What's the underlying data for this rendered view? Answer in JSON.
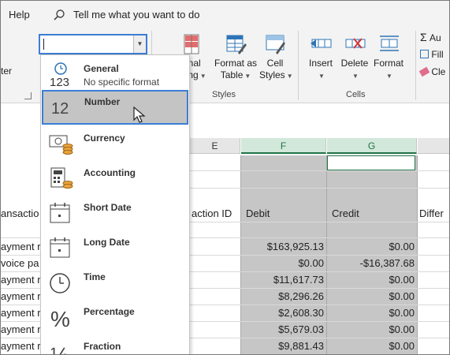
{
  "menubar": {
    "help": "Help",
    "tell_me": "Tell me what you want to do"
  },
  "ribbon": {
    "left_cut_label": "ter",
    "number_format_value": "",
    "conditional_line1": "ional",
    "conditional_line2": "atting",
    "format_as_table_line1": "Format as",
    "format_as_table_line2": "Table",
    "cell_styles_line1": "Cell",
    "cell_styles_line2": "Styles",
    "styles_group": "Styles",
    "insert": "Insert",
    "delete": "Delete",
    "format": "Format",
    "cells_group": "Cells",
    "autosum": "Au",
    "fill": "Fill",
    "clear": "Cle"
  },
  "dropdown": {
    "items": [
      {
        "label": "General",
        "sub": "No specific format",
        "icon": "general-123-icon"
      },
      {
        "label": "Number",
        "sub": "",
        "icon": "number-12-icon"
      },
      {
        "label": "Currency",
        "sub": "",
        "icon": "currency-icon"
      },
      {
        "label": "Accounting",
        "sub": "",
        "icon": "accounting-icon"
      },
      {
        "label": "Short Date",
        "sub": "",
        "icon": "short-date-icon"
      },
      {
        "label": "Long Date",
        "sub": "",
        "icon": "long-date-icon"
      },
      {
        "label": "Time",
        "sub": "",
        "icon": "clock-icon"
      },
      {
        "label": "Percentage",
        "sub": "",
        "icon": "percent-icon"
      },
      {
        "label": "Fraction",
        "sub": "",
        "icon": "fraction-icon"
      }
    ],
    "number_glyph": "12",
    "general_glyph": "123",
    "percent_glyph": "%",
    "fraction_glyph": "½"
  },
  "sheet": {
    "columns": {
      "e": "E",
      "f": "F",
      "g": "G"
    },
    "headers": {
      "transaction_cut": "ansactio",
      "transaction_id_cut": "action ID",
      "debit": "Debit",
      "credit": "Credit",
      "difference_cut": "Differ"
    },
    "left_labels": [
      "ayment r",
      "voice pa",
      "ayment r",
      "ayment r",
      "ayment r",
      "ayment r",
      "ayment r"
    ],
    "debit": [
      "$163,925.13",
      "$0.00",
      "$11,617.73",
      "$8,296.26",
      "$2,608.30",
      "$5,679.03",
      "$9,881.43"
    ],
    "credit": [
      "$0.00",
      "-$16,387.68",
      "$0.00",
      "$0.00",
      "$0.00",
      "$0.00",
      "$0.00"
    ]
  },
  "colors": {
    "accent_blue": "#3c7dd4",
    "excel_green": "#217346",
    "selection_gray": "#c6c6c6"
  }
}
